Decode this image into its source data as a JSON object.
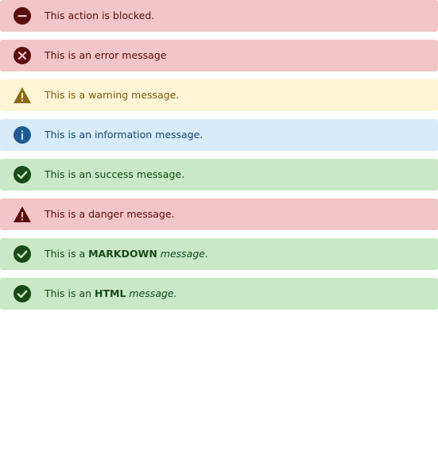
{
  "messages": [
    {
      "type": "blocked",
      "icon": "blocked-icon",
      "text": "This action is blocked."
    },
    {
      "type": "error",
      "icon": "error-icon",
      "text": "This is an error message"
    },
    {
      "type": "warning",
      "icon": "warning-icon",
      "text": "This is a warning message."
    },
    {
      "type": "info",
      "icon": "info-icon",
      "text": "This is an information message."
    },
    {
      "type": "success",
      "icon": "success-icon",
      "text": "This is an success message."
    },
    {
      "type": "danger",
      "icon": "danger-icon",
      "text": "This is a danger message."
    },
    {
      "type": "markdown",
      "icon": "success-icon",
      "prefix": "This is a ",
      "bold": "MARKDOWN",
      "italic": "message."
    },
    {
      "type": "html",
      "icon": "success-icon",
      "prefix": "This is an ",
      "bold": "HTML",
      "italic": "message."
    }
  ],
  "colors": {
    "blocked_bg": "#f2c6c8",
    "danger_icon": "#5a0c0c",
    "warning_bg": "#fff4d6",
    "warning_icon": "#8a6a12",
    "info_bg": "#d7ebfb",
    "info_icon": "#1f5b93",
    "success_bg": "#c9e8c6",
    "success_icon": "#174a17"
  }
}
